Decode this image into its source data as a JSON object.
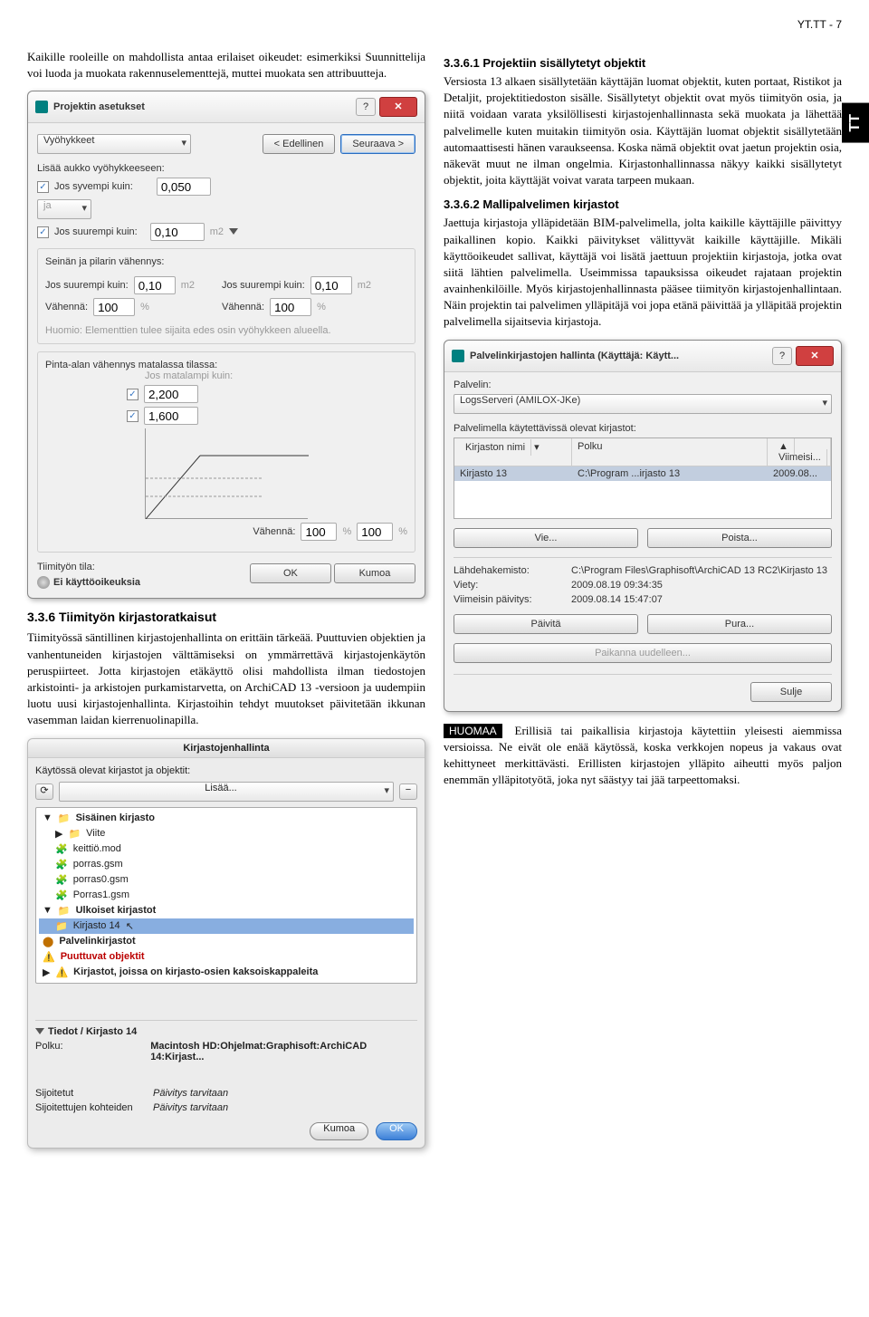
{
  "page_header": "YT.TT - 7",
  "tt_tab": "TT",
  "intro_para": "Kaikille rooleille on mahdollista antaa erilaiset oikeudet: esimerkiksi Suunnittelija voi luoda ja muokata rakennuselementtejä, muttei muokata sen attribuutteja.",
  "dlg1": {
    "title": "Projektin asetukset",
    "tab": "Vyöhykkeet",
    "prev": "< Edellinen",
    "next": "Seuraava >",
    "sec_a": "Lisää aukko vyöhykkeeseen:",
    "chk_sy": "Jos syvempi kuin:",
    "v_sy": "0,050",
    "dd_ja": "ja",
    "chk_su": "Jos suurempi kuin:",
    "v_su": "0,10",
    "unit_m2": "m2",
    "sec_b": "Seinän ja pilarin vähennys:",
    "v_su2": "0,10",
    "vahenna": "Vähennä:",
    "v_100": "100",
    "pct": "%",
    "huomio": "Huomio:    Elementtien tulee sijaita edes osin vyöhykkeen alueella.",
    "sec_c": "Pinta-alan vähennys matalassa tilassa:",
    "c1": "2,200",
    "c2": "1,600",
    "jos_mat": "Jos matalampi kuin:",
    "tiimityon": "Tiimityön tila:",
    "ei_oik": "Ei käyttöoikeuksia",
    "ok": "OK",
    "kumoa": "Kumoa"
  },
  "sec336_h": "3.3.6    Tiimityön kirjastoratkaisut",
  "sec336_p": "Tiimityössä säntillinen kirjastojenhallinta on erittäin tärkeää. Puuttuvien objektien ja vanhentuneiden kirjastojen välttämiseksi on ymmärrettävä kirjastojenkäytön peruspiirteet. Jotta kirjastojen etäkäyttö olisi mahdollista ilman tiedostojen arkistointi- ja arkistojen purkamistarvetta, on ArchiCAD 13 -versioon ja uudempiin luotu uusi kirjastojenhallinta. Kirjastoihin tehdyt muutokset päivitetään ikkunan vasemman laidan kierrenuolinapilla.",
  "mac": {
    "title": "Kirjastojenhallinta",
    "sub": "Käytössä olevat kirjastot ja objektit:",
    "lisaa": "Lisää...",
    "items": {
      "i0": "Sisäinen kirjasto",
      "i1": "Viite",
      "i2": "keittiö.mod",
      "i3": "porras.gsm",
      "i4": "porras0.gsm",
      "i5": "Porras1.gsm",
      "i6": "Ulkoiset kirjastot",
      "i7": "Kirjasto 14",
      "i8": "Palvelinkirjastot",
      "i9": "Puuttuvat objektit",
      "i10": "Kirjastot, joissa on kirjasto-osien kaksoiskappaleita"
    },
    "tiedot": "Tiedot / Kirjasto 14",
    "polku_l": "Polku:",
    "polku_v": "Macintosh HD:Ohjelmat:Graphisoft:ArchiCAD 14:Kirjast...",
    "sij": "Sijoitetut",
    "sijk": "Sijoitettujen kohteiden",
    "paiv": "Päivitys tarvitaan",
    "kumoa": "Kumoa",
    "ok": "OK"
  },
  "r": {
    "h1": "3.3.6.1 Projektiin sisällytetyt objektit",
    "p1": "Versiosta 13 alkaen sisällytetään käyttäjän luomat objektit, kuten portaat, Ristikot ja Detaljit, projektitiedoston sisälle. Sisällytetyt objektit ovat myös tiimityön osia, ja niitä voidaan varata yksilöllisesti kirjastojenhallinnasta sekä muokata ja lähettää palvelimelle kuten muitakin tiimityön osia. Käyttäjän luomat objektit sisällytetään automaattisesti hänen varaukseensa. Koska nämä objektit ovat jaetun projektin osia, näkevät muut ne ilman ongelmia. Kirjastonhallinnassa näkyy kaikki sisällytetyt objektit, joita käyttäjät voivat varata tarpeen mukaan.",
    "h2": "3.3.6.2 Mallipalvelimen kirjastot",
    "p2": "Jaettuja kirjastoja ylläpidetään BIM-palvelimella, jolta kaikille käyttäjille päivittyy paikallinen kopio. Kaikki päivitykset välittyvät kaikille käyttäjille. Mikäli käyttöoikeudet sallivat, käyttäjä voi lisätä jaettuun projektiin kirjastoja, jotka ovat siitä lähtien palvelimella. Useimmissa tapauksissa oikeudet rajataan projektin avainhenkilöille. Myös kirjastojenhallinnasta pääsee tiimityön kirjastojenhallintaan. Näin projektin tai palvelimen ylläpitäjä voi jopa etänä päivittää ja ylläpitää projektin palvelimella sijaitsevia kirjastoja."
  },
  "dlg2": {
    "title": "Palvelinkirjastojen hallinta (Käyttäjä: Käytt...",
    "palvelin": "Palvelin:",
    "srv": "LogsServeri (AMILOX-JKe)",
    "avail": "Palvelimella käytettävissä olevat kirjastot:",
    "th1": "Kirjaston nimi",
    "th2": "Polku",
    "th3": "Viimeisi...",
    "r1a": "Kirjasto 13",
    "r1b": "C:\\Program ...irjasto 13",
    "r1c": "2009.08...",
    "vie": "Vie...",
    "poista": "Poista...",
    "lh_l": "Lähdehakemisto:",
    "lh_v": "C:\\Program Files\\Graphisoft\\ArchiCAD 13 RC2\\Kirjasto 13",
    "viety_l": "Viety:",
    "viety_v": "2009.08.19 09:34:35",
    "viim_l": "Viimeisin päivitys:",
    "viim_v": "2009.08.14 15:47:07",
    "paivita": "Päivitä",
    "pura": "Pura...",
    "paikanna": "Paikanna uudelleen...",
    "sulje": "Sulje"
  },
  "note": {
    "badge": "HUOMAA",
    "text": " Erillisiä tai paikallisia kirjastoja käytettiin yleisesti aiemmissa versioissa. Ne eivät ole enää käytössä, koska verkkojen nopeus ja vakaus ovat kehittyneet merkittävästi. Erillisten kirjastojen ylläpito aiheutti myös paljon enemmän ylläpitotyötä, joka nyt säästyy tai jää tarpeettomaksi."
  }
}
